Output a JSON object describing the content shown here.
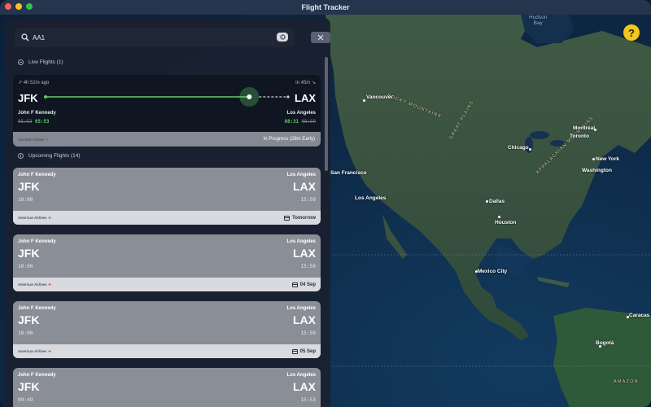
{
  "window": {
    "title": "Flight Tracker"
  },
  "search": {
    "value": "AA1"
  },
  "help": {
    "label": "?"
  },
  "map": {
    "labels": {
      "hudson_bay": "Hudson\nBay",
      "vancouver": "Vancouver",
      "san_francisco": "San Francisco",
      "los_angeles": "Los Angeles",
      "dallas": "Dallas",
      "houston": "Houston",
      "chicago": "Chicago",
      "montreal": "Montréal",
      "toronto": "Toronto",
      "new_york": "New York",
      "washington": "Washington",
      "mexico_city": "Mexico City",
      "caracas": "Caracas",
      "bogota": "Bogotá",
      "rocky": "ROCKY MOUNTAINS",
      "great_plains": "GREAT PLAINS",
      "appalachian": "APPALACHIAN MOUNTAINS",
      "amazon": "AMAZON"
    }
  },
  "live": {
    "header": "Live Flights (1)",
    "elapsed": "4h 52m ago",
    "remaining": "in 45m",
    "origin_code": "JFK",
    "dest_code": "LAX",
    "origin_city": "John F Kennedy",
    "dest_city": "Los Angeles",
    "dep_sched": "05:53",
    "dep_actual": "05:53",
    "arr_actual": "08:31",
    "arr_sched": "08:59",
    "progress": 0.84,
    "status": "In Progress (28m Early)",
    "airline": "American Airlines"
  },
  "upcoming": {
    "header": "Upcoming Flights (14)",
    "flights": [
      {
        "origin_city": "John F Kennedy",
        "dest_city": "Los Angeles",
        "origin_code": "JFK",
        "dest_code": "LAX",
        "dep": "10:00",
        "arr": "15:59",
        "date": "Tomorrow",
        "airline": "American Airlines"
      },
      {
        "origin_city": "John F Kennedy",
        "dest_city": "Los Angeles",
        "origin_code": "JFK",
        "dest_code": "LAX",
        "dep": "10:00",
        "arr": "15:59",
        "date": "04 Sep",
        "airline": "American Airlines"
      },
      {
        "origin_city": "John F Kennedy",
        "dest_city": "Los Angeles",
        "origin_code": "JFK",
        "dest_code": "LAX",
        "dep": "10:00",
        "arr": "15:59",
        "date": "05 Sep",
        "airline": "American Airlines"
      },
      {
        "origin_city": "John F Kennedy",
        "dest_city": "Los Angeles",
        "origin_code": "JFK",
        "dest_code": "LAX",
        "dep": "09:49",
        "arr": "15:53",
        "date": "",
        "airline": "American Airlines"
      }
    ]
  },
  "colors": {
    "accent_green": "#5fd067",
    "help_yellow": "#f2c81e"
  }
}
